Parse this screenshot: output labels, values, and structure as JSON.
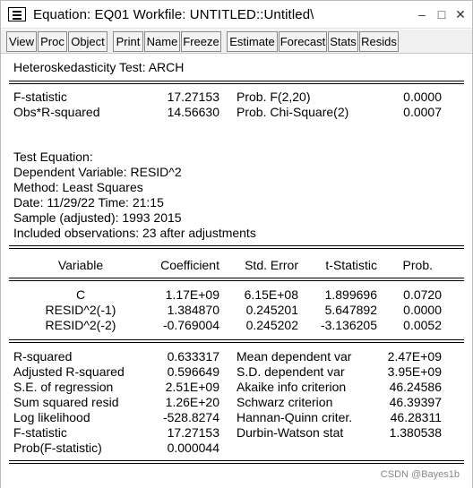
{
  "window": {
    "title": "Equation: EQ01    Workfile: UNTITLED::Untitled\\",
    "minimize_glyph": "–",
    "maximize_glyph": "□",
    "close_glyph": "✕"
  },
  "toolbar": {
    "buttons": [
      "View",
      "Proc",
      "Object",
      "Print",
      "Name",
      "Freeze",
      "Estimate",
      "Forecast",
      "Stats",
      "Resids"
    ]
  },
  "output": {
    "test_title": "Heteroskedasticity Test: ARCH",
    "summary": [
      {
        "label": "F-statistic",
        "value": "17.27153",
        "prob_label": "Prob. F(2,20)",
        "prob_value": "0.0000"
      },
      {
        "label": "Obs*R-squared",
        "value": "14.56630",
        "prob_label": "Prob. Chi-Square(2)",
        "prob_value": "0.0007"
      }
    ],
    "info": [
      "Test Equation:",
      "Dependent Variable: RESID^2",
      "Method: Least Squares",
      "Date: 11/29/22   Time: 21:15",
      "Sample (adjusted): 1993 2015",
      "Included observations: 23 after adjustments"
    ],
    "coef_headers": {
      "variable": "Variable",
      "coefficient": "Coefficient",
      "std_error": "Std. Error",
      "t_stat": "t-Statistic",
      "prob": "Prob."
    },
    "coef_rows": [
      {
        "variable": "C",
        "coefficient": "1.17E+09",
        "std_error": "6.15E+08",
        "t_stat": "1.899696",
        "prob": "0.0720"
      },
      {
        "variable": "RESID^2(-1)",
        "coefficient": "1.384870",
        "std_error": "0.245201",
        "t_stat": "5.647892",
        "prob": "0.0000"
      },
      {
        "variable": "RESID^2(-2)",
        "coefficient": "-0.769004",
        "std_error": "0.245202",
        "t_stat": "-3.136205",
        "prob": "0.0052"
      }
    ],
    "stats": [
      {
        "label": "R-squared",
        "value": "0.633317",
        "label2": "Mean dependent var",
        "value2": "2.47E+09"
      },
      {
        "label": "Adjusted R-squared",
        "value": "0.596649",
        "label2": "S.D. dependent var",
        "value2": "3.95E+09"
      },
      {
        "label": "S.E. of regression",
        "value": "2.51E+09",
        "label2": "Akaike info criterion",
        "value2": "46.24586"
      },
      {
        "label": "Sum squared resid",
        "value": "1.26E+20",
        "label2": "Schwarz criterion",
        "value2": "46.39397"
      },
      {
        "label": "Log likelihood",
        "value": "-528.8274",
        "label2": "Hannan-Quinn criter.",
        "value2": "46.28311"
      },
      {
        "label": "F-statistic",
        "value": "17.27153",
        "label2": "Durbin-Watson stat",
        "value2": "1.380538"
      },
      {
        "label": "Prob(F-statistic)",
        "value": "0.000044",
        "label2": "",
        "value2": ""
      }
    ]
  },
  "watermark": "CSDN @Bayes1b"
}
